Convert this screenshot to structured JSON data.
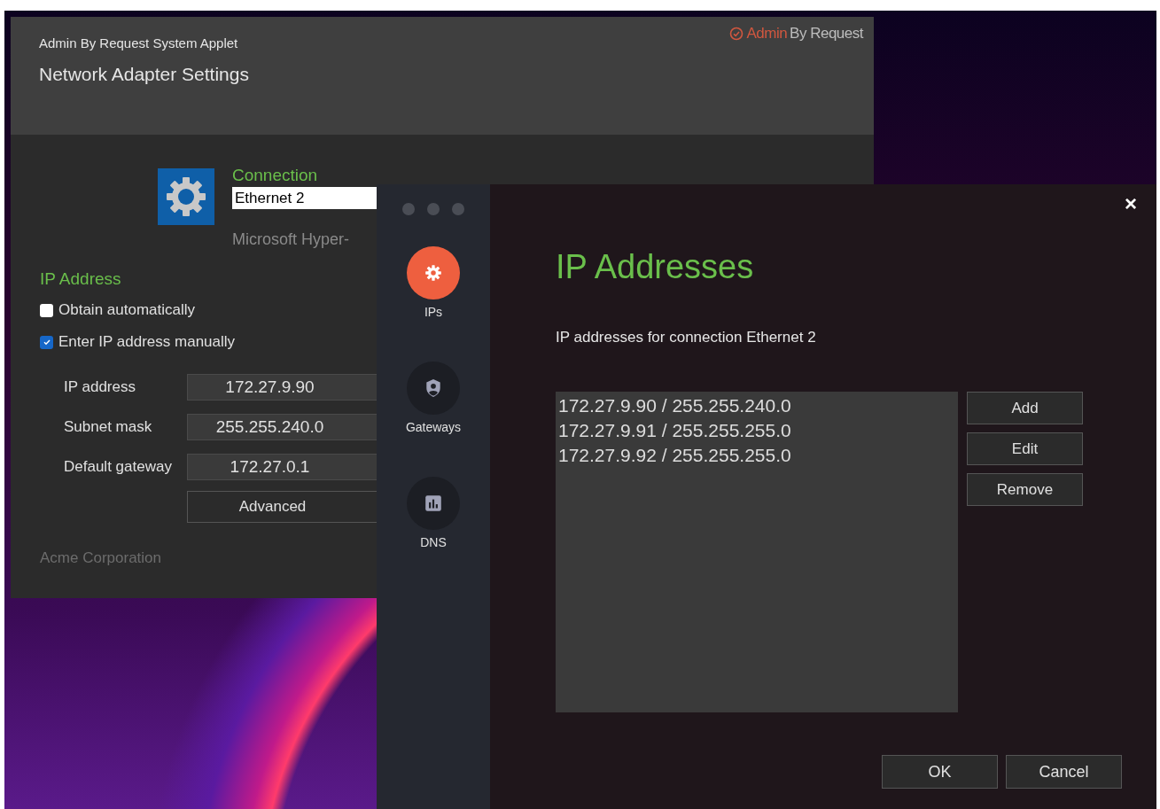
{
  "background_window": {
    "app_name": "Admin By Request System Applet",
    "title": "Network Adapter Settings",
    "brand": {
      "accent": "Admin",
      "rest": "By Request"
    },
    "connection_label": "Connection",
    "connection_name": "Ethernet 2",
    "adapter": "Microsoft Hyper-",
    "ip_section": "IP Address",
    "options": [
      {
        "label": "Obtain automatically",
        "checked": false
      },
      {
        "label": "Enter IP address manually",
        "checked": true
      }
    ],
    "fields": [
      {
        "label": "IP address",
        "value": "172.27.9.90"
      },
      {
        "label": "Subnet mask",
        "value": "255.255.240.0"
      },
      {
        "label": "Default gateway",
        "value": "172.27.0.1"
      }
    ],
    "advanced_button": "Advanced",
    "footer": "Acme Corporation"
  },
  "dialog": {
    "close": "×",
    "nav": [
      {
        "label": "IPs",
        "kind": "gear",
        "selected": true
      },
      {
        "label": "Gateways",
        "kind": "shield",
        "selected": false
      },
      {
        "label": "DNS",
        "kind": "chart",
        "selected": false
      }
    ],
    "title": "IP Addresses",
    "subtitle": "IP addresses for connection Ethernet 2",
    "addresses": [
      "172.27.9.90 / 255.255.240.0",
      "172.27.9.91 / 255.255.255.0",
      "172.27.9.92 / 255.255.255.0"
    ],
    "side_buttons": [
      "Add",
      "Edit",
      "Remove"
    ],
    "footer_buttons": [
      "OK",
      "Cancel"
    ]
  }
}
